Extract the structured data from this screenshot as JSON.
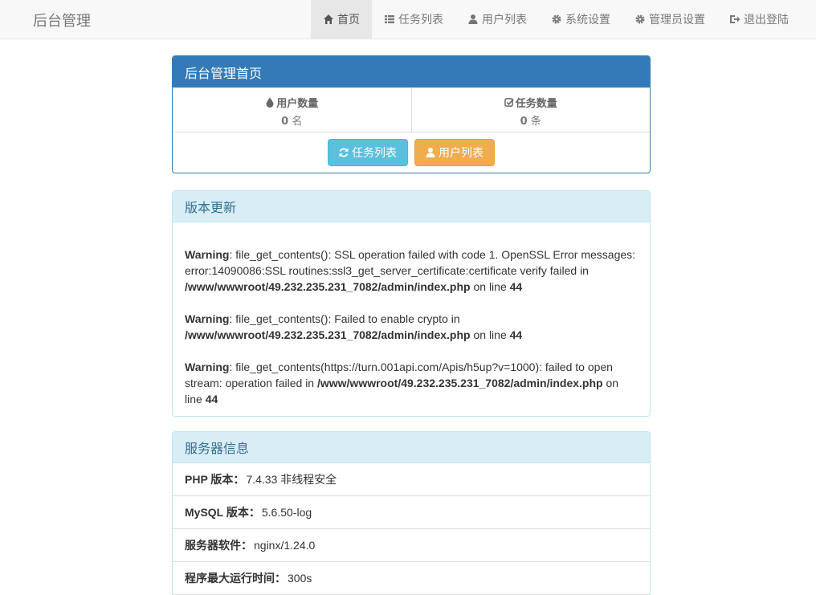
{
  "navbar": {
    "brand": "后台管理",
    "items": [
      {
        "label": "首页",
        "icon": "home-icon",
        "active": true
      },
      {
        "label": "任务列表",
        "icon": "list-icon"
      },
      {
        "label": "用户列表",
        "icon": "user-icon"
      },
      {
        "label": "系统设置",
        "icon": "gear-icon"
      },
      {
        "label": "管理员设置",
        "icon": "gear-icon"
      },
      {
        "label": "退出登陆",
        "icon": "logout-icon"
      }
    ]
  },
  "dashboard": {
    "title": "后台管理首页",
    "users": {
      "label": "用户数量",
      "count": "0",
      "unit": "名"
    },
    "tasks": {
      "label": "任务数量",
      "count": "0",
      "unit": "条"
    },
    "btn_tasks": "任务列表",
    "btn_users": "用户列表"
  },
  "update": {
    "title": "版本更新",
    "warnings": [
      {
        "label": "Warning",
        "msg": ": file_get_contents(): SSL operation failed with code 1. OpenSSL Error messages: error:14090086:SSL routines:ssl3_get_server_certificate:certificate verify failed in ",
        "path": "/www/wwwroot/49.232.235.231_7082/admin/index.php",
        "online": " on line ",
        "line": "44"
      },
      {
        "label": "Warning",
        "msg": ": file_get_contents(): Failed to enable crypto in ",
        "path": "/www/wwwroot/49.232.235.231_7082/admin/index.php",
        "online": " on line ",
        "line": "44"
      },
      {
        "label": "Warning",
        "msg": ": file_get_contents(https://turn.001api.com/Apis/h5up?v=1000): failed to open stream: operation failed in ",
        "path": "/www/wwwroot/49.232.235.231_7082/admin/index.php",
        "online": " on line ",
        "line": "44"
      }
    ]
  },
  "server": {
    "title": "服务器信息",
    "rows": [
      {
        "key": "PHP 版本：",
        "value": "7.4.33 非线程安全"
      },
      {
        "key": "MySQL 版本：",
        "value": "5.6.50-log"
      },
      {
        "key": "服务器软件：",
        "value": "nginx/1.24.0"
      },
      {
        "key": "程序最大运行时间：",
        "value": "300s"
      }
    ]
  }
}
